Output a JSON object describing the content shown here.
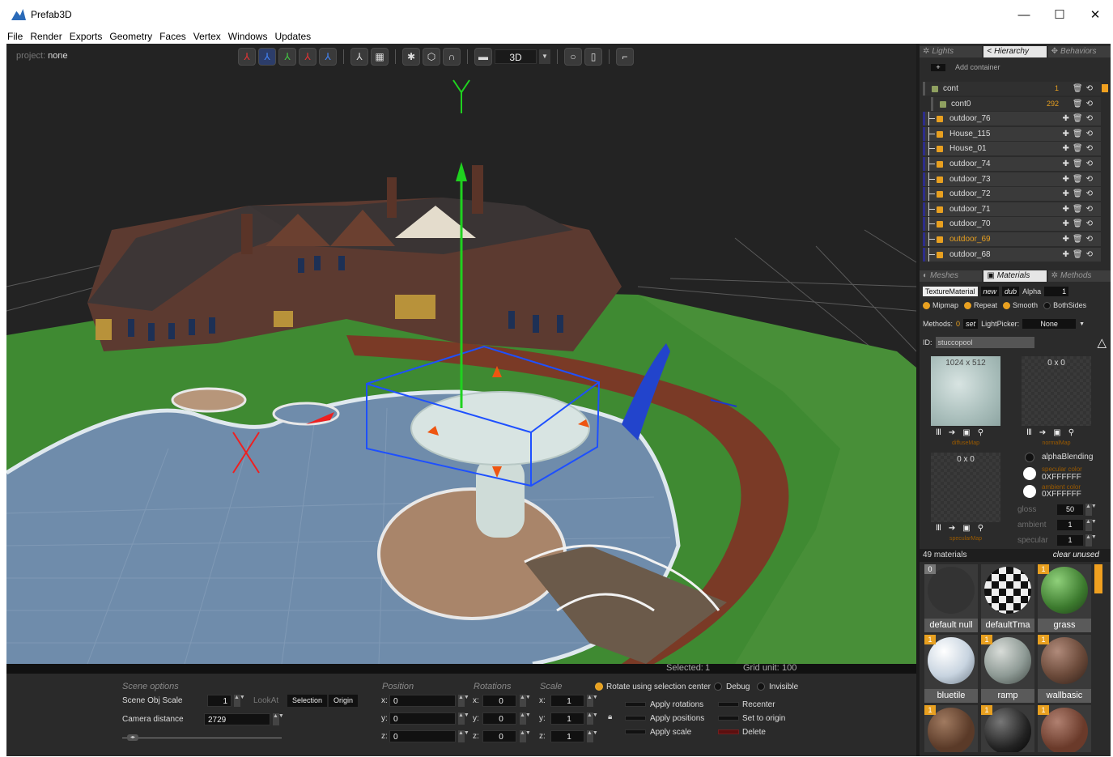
{
  "window": {
    "title": "Prefab3D",
    "controls": [
      "—",
      "☐",
      "✕"
    ]
  },
  "menu": [
    "File",
    "Render",
    "Exports",
    "Geometry",
    "Faces",
    "Vertex",
    "Windows",
    "Updates"
  ],
  "viewport": {
    "project_label": "project:",
    "project_name": "none",
    "view_mode": "3D",
    "axis_y_label": "Y"
  },
  "status": {
    "selected_label": "Selected:",
    "selected_value": "1",
    "grid_label": "Grid unit:",
    "grid_value": "100"
  },
  "scene_options": {
    "title": "Scene options",
    "obj_scale_label": "Scene Obj Scale",
    "obj_scale_value": "1",
    "lookat_label": "LookAt",
    "selection_btn": "Selection",
    "origin_btn": "Origin",
    "camera_distance_label": "Camera distance",
    "camera_distance_value": "2729"
  },
  "transform": {
    "position_title": "Position",
    "rotations_title": "Rotations",
    "scale_title": "Scale",
    "position": {
      "x": "0",
      "y": "0",
      "z": "0"
    },
    "rotations": {
      "x": "0",
      "y": "0",
      "z": "0"
    },
    "scale": {
      "x": "1",
      "y": "1",
      "z": "1"
    },
    "rotate_center_label": "Rotate using selection center",
    "debug_label": "Debug",
    "invisible_label": "Invisible",
    "apply_rotations": "Apply rotations",
    "apply_positions": "Apply positions",
    "apply_scale": "Apply scale",
    "recenter": "Recenter",
    "set_to_origin": "Set to origin",
    "delete": "Delete"
  },
  "right_panel": {
    "top_tabs": [
      "Lights",
      "Hierarchy",
      "Behaviors"
    ],
    "add_container": "Add container",
    "hierarchy": [
      {
        "name": "cont",
        "count": "1",
        "type": "container"
      },
      {
        "name": "cont0",
        "count": "292",
        "type": "container"
      },
      {
        "name": "outdoor_76",
        "type": "mesh"
      },
      {
        "name": "House_115",
        "type": "mesh"
      },
      {
        "name": "House_01",
        "type": "mesh"
      },
      {
        "name": "outdoor_74",
        "type": "mesh"
      },
      {
        "name": "outdoor_73",
        "type": "mesh"
      },
      {
        "name": "outdoor_72",
        "type": "mesh"
      },
      {
        "name": "outdoor_71",
        "type": "mesh"
      },
      {
        "name": "outdoor_70",
        "type": "mesh"
      },
      {
        "name": "outdoor_69",
        "type": "mesh",
        "selected": true
      },
      {
        "name": "outdoor_68",
        "type": "mesh"
      }
    ],
    "mid_tabs": [
      "Meshes",
      "Materials",
      "Methods"
    ],
    "material_type": "TextureMaterial",
    "new_label": "new",
    "dub_label": "dub",
    "alpha_label": "Alpha",
    "alpha_value": "1",
    "flags": [
      {
        "label": "Mipmap",
        "on": true
      },
      {
        "label": "Repeat",
        "on": true
      },
      {
        "label": "Smooth",
        "on": true
      },
      {
        "label": "BothSides",
        "on": false
      }
    ],
    "methods_label": "Methods:",
    "methods_value": "0",
    "set_label": "set",
    "lightpicker_label": "LightPicker:",
    "lightpicker_value": "None",
    "id_label": "ID:",
    "id_value": "stuccopool",
    "diffuse_size": "1024 x 512",
    "normal_size": "0 x 0",
    "specular_size": "0 x 0",
    "diffuse_caption": "diffuseMap",
    "normal_caption": "normalMap",
    "specular_caption": "specularMap",
    "alpha_blending": "alphaBlending",
    "specular_color_label": "specular color",
    "specular_color": "0XFFFFFF",
    "ambient_color_label": "ambient color",
    "ambient_color": "0XFFFFFF",
    "gloss_label": "gloss",
    "gloss_value": "50",
    "ambient_label": "ambient",
    "ambient_value": "1",
    "specular_label": "specular",
    "specular_value": "1",
    "materials_count": "49 materials",
    "clear_unused": "clear unused",
    "materials": [
      {
        "name": "default null",
        "count": "0"
      },
      {
        "name": "defaultTma",
        "count": ""
      },
      {
        "name": "grass",
        "count": "1"
      },
      {
        "name": "bluetile",
        "count": "1"
      },
      {
        "name": "ramp",
        "count": "1"
      },
      {
        "name": "wallbasic",
        "count": "1"
      },
      {
        "name": "",
        "count": "1"
      },
      {
        "name": "",
        "count": "1"
      },
      {
        "name": "",
        "count": "1"
      }
    ]
  },
  "colors": {
    "accent": "#e8a020",
    "panel_bg": "#2b2b2b",
    "gizmo_y": "#22cc22",
    "gizmo_box": "#2255ff"
  }
}
